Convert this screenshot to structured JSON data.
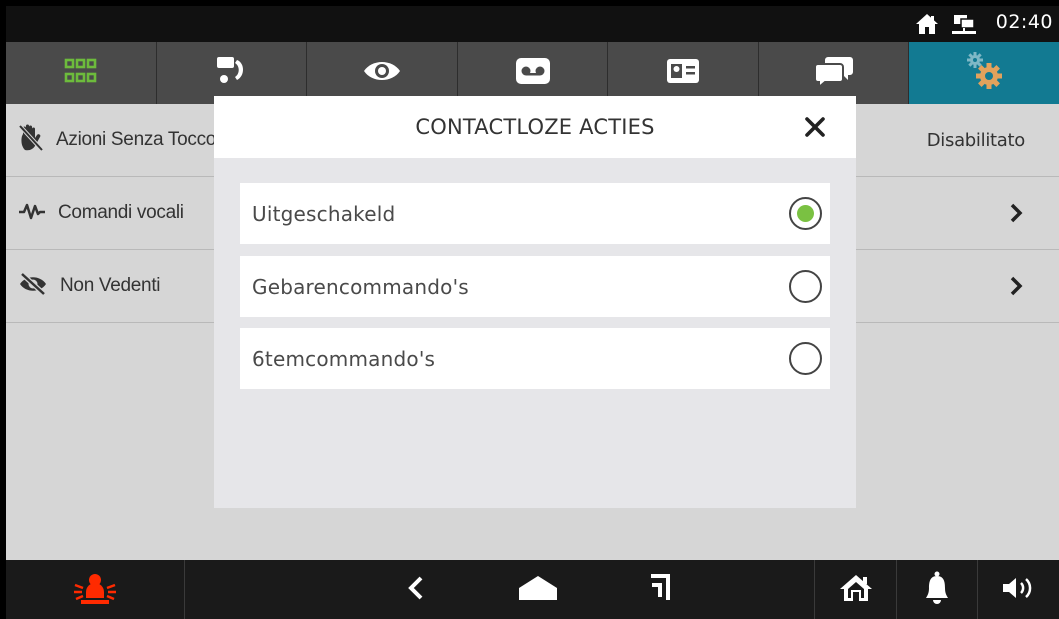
{
  "status_bar": {
    "time": "02:40",
    "icons": [
      "home-icon",
      "network-icon"
    ]
  },
  "tabs": [
    {
      "name": "grid-icon",
      "active": false
    },
    {
      "name": "intercom-call-icon",
      "active": false
    },
    {
      "name": "eye-icon",
      "active": false
    },
    {
      "name": "voicemail-icon",
      "active": false
    },
    {
      "name": "contact-card-icon",
      "active": false
    },
    {
      "name": "chat-bubbles-icon",
      "active": false
    },
    {
      "name": "settings-gears-icon",
      "active": true
    }
  ],
  "settings_list": [
    {
      "label": "Azioni Senza Tocco",
      "value": "Disabilitato",
      "icon": "touchless-hand-icon"
    },
    {
      "label": "Comandi vocali",
      "value": "",
      "icon": "voice-wave-icon"
    },
    {
      "label": "Non Vedenti",
      "value": "",
      "icon": "eye-slash-icon"
    }
  ],
  "dialog": {
    "title": "CONTACTLOZE ACTIES",
    "close_icon": "close-icon",
    "options": [
      {
        "label": "Uitgeschakeld",
        "checked": true
      },
      {
        "label": "Gebarencommando's",
        "checked": false
      },
      {
        "label": "6temcommando's",
        "checked": false
      }
    ]
  },
  "bottom_bar": {
    "icons": [
      "alarm-bug-icon",
      "back-icon",
      "home-shape-icon",
      "recent-apps-icon",
      "house-icon",
      "bell-icon",
      "speaker-icon"
    ]
  },
  "colors": {
    "active_tab": "#127a92",
    "tab_icon_green": "#6dbb3c",
    "radio_checked": "#7ac142",
    "alarm_red": "#ff2a00"
  }
}
